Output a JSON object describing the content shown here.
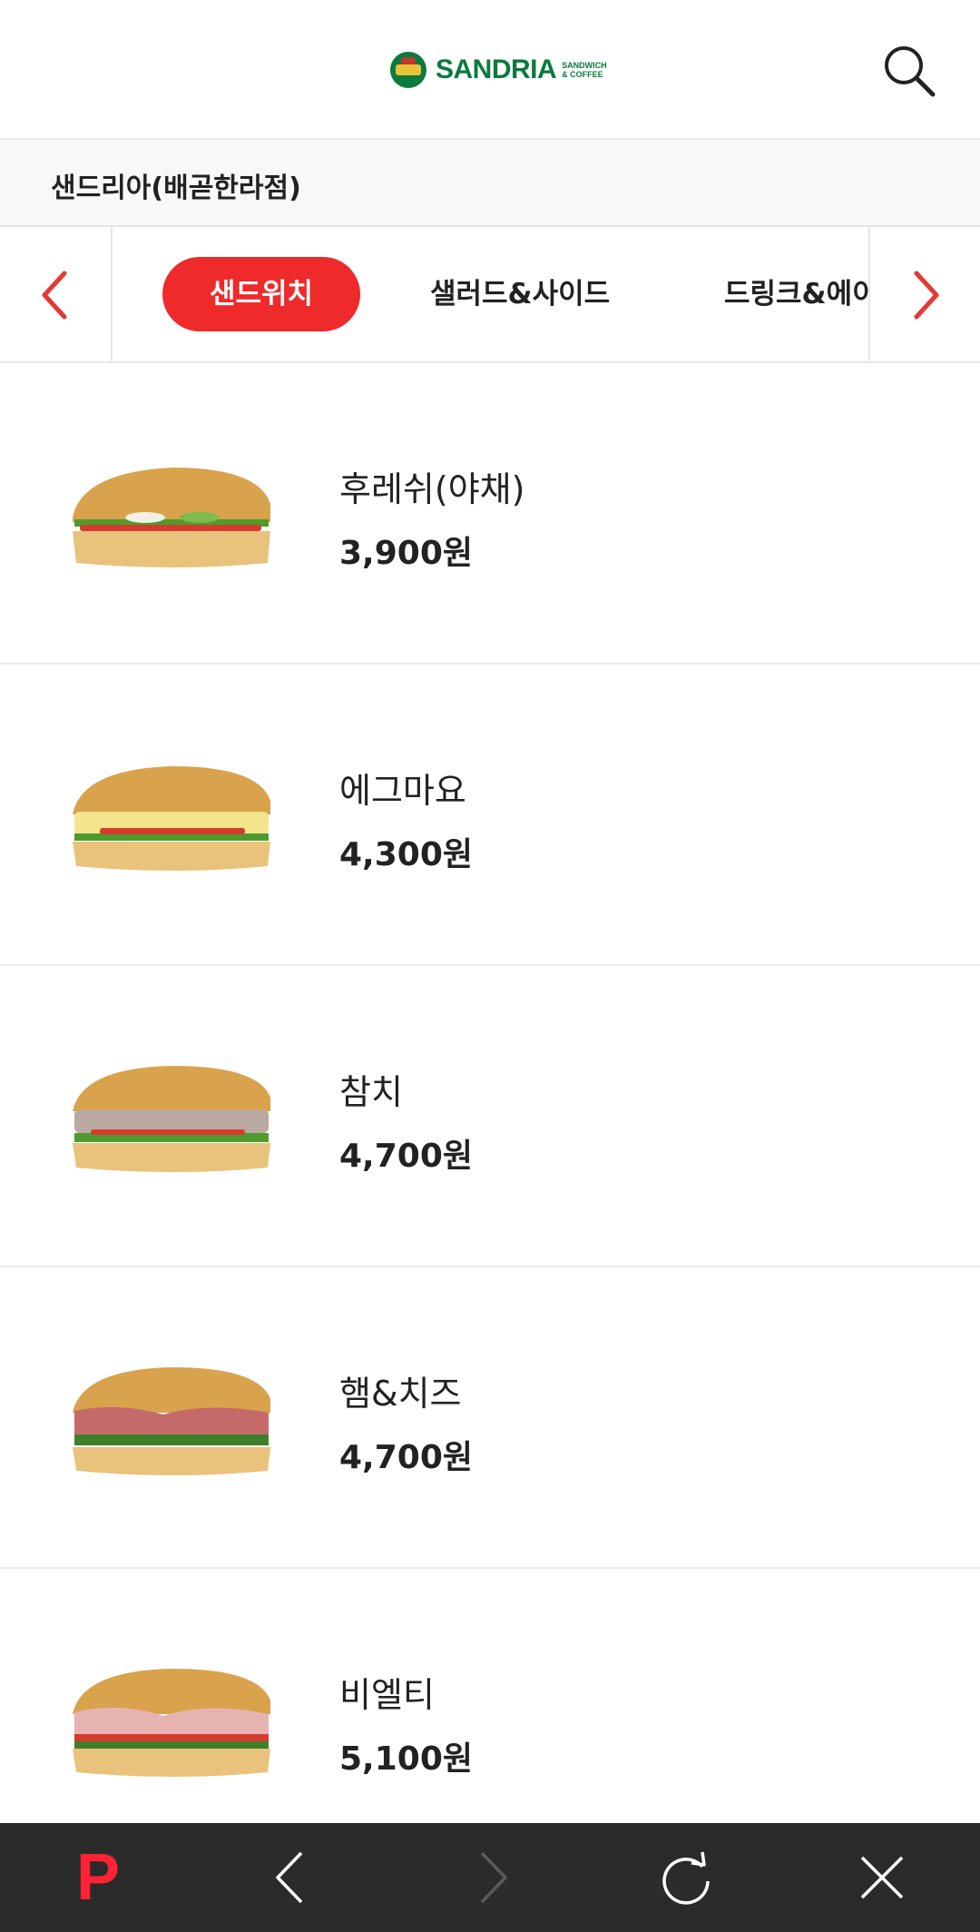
{
  "header": {
    "brand": "SANDRIA",
    "brand_sub_1": "SANDWICH",
    "brand_sub_2": "& COFFEE"
  },
  "store": {
    "name": "샌드리아(배곧한라점)"
  },
  "categories": [
    {
      "label": "샌드위치",
      "active": true
    },
    {
      "label": "샐러드&사이드",
      "active": false
    },
    {
      "label": "드링크&에이",
      "active": false
    }
  ],
  "menu": [
    {
      "name": "후레쉬(야채)",
      "price": "3,900원",
      "filling": "veggie"
    },
    {
      "name": "에그마요",
      "price": "4,300원",
      "filling": "egg"
    },
    {
      "name": "참치",
      "price": "4,700원",
      "filling": "tuna"
    },
    {
      "name": "햄&치즈",
      "price": "4,700원",
      "filling": "ham"
    },
    {
      "name": "비엘티",
      "price": "5,100원",
      "filling": "blt"
    }
  ],
  "bottom_bar": {
    "logo": "P"
  },
  "colors": {
    "accent": "#ee2a2a",
    "brand": "#0b7a3e",
    "bottom_bar": "#2b2b2b"
  }
}
